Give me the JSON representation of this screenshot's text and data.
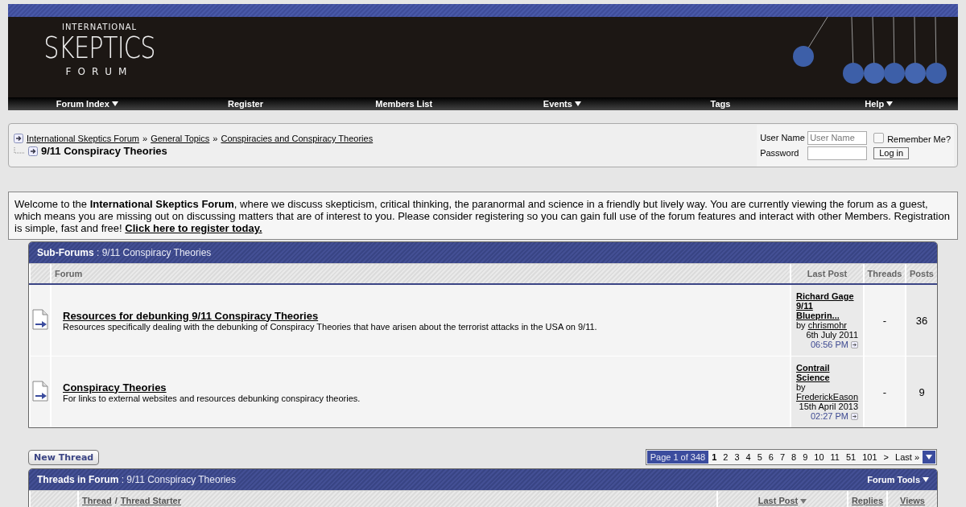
{
  "logo": {
    "line_1": "INTERNATIONAL",
    "line_2": "SKEPTICS",
    "line_3": "FORUM"
  },
  "nav": [
    {
      "label": "Forum Index",
      "dropdown": true
    },
    {
      "label": "Register",
      "dropdown": false
    },
    {
      "label": "Members List",
      "dropdown": false
    },
    {
      "label": "Events",
      "dropdown": true
    },
    {
      "label": "Tags",
      "dropdown": false
    },
    {
      "label": "Help",
      "dropdown": true
    }
  ],
  "breadcrumb": {
    "links": [
      "International Skeptics Forum",
      "General Topics",
      "Conspiracies and Conspiracy Theories"
    ],
    "separator": "»",
    "current": "9/11 Conspiracy Theories"
  },
  "login": {
    "username_label": "User Name",
    "username_placeholder": "User Name",
    "password_label": "Password",
    "remember_label": "Remember Me?",
    "remember_checked": false,
    "button": "Log in"
  },
  "welcome": {
    "text": "Welcome to the **International Skeptics Forum**, where we discuss skepticism, critical thinking, the paranormal and science in a friendly but lively way. You are currently viewing the forum as a guest, which means you are missing out on discussing matters that are of interest to you. Please consider registering so you can gain full use of the forum features and interact with other Members. Registration is simple, fast and free!",
    "link": "Click here to register today."
  },
  "subforums": {
    "title": "Sub-Forums",
    "subtitle": ": 9/11 Conspiracy Theories",
    "columns": [
      "Forum",
      "Last Post",
      "Threads",
      "Posts"
    ],
    "rows": [
      {
        "title": "Resources for debunking 9/11 Conspiracy Theories",
        "description": "Resources specifically dealing with the debunking of Conspiracy Theories that have arisen about the terrorist attacks in the USA on 9/11.",
        "last_title": "Richard Gage 9/11 Blueprin...",
        "last_by": "by",
        "last_user": "chrismohr",
        "last_date": "6th July 2011",
        "last_time": "06:56 PM",
        "threads": "-",
        "posts": "36"
      },
      {
        "title": "Conspiracy Theories",
        "description": "For links to external websites and resources debunking conspiracy theories.",
        "last_title": "Contrail Science",
        "last_by": "by",
        "last_user": "FrederickEason",
        "last_date": "15th April 2013",
        "last_time": "02:27 PM",
        "threads": "-",
        "posts": "9"
      }
    ]
  },
  "new_thread_button": "New Thread",
  "pagination": {
    "label": "Page 1 of 348",
    "pages": [
      {
        "label": "1",
        "selected": true
      },
      {
        "label": "2",
        "selected": false
      },
      {
        "label": "3",
        "selected": false
      },
      {
        "label": "4",
        "selected": false
      },
      {
        "label": "5",
        "selected": false
      },
      {
        "label": "6",
        "selected": false
      },
      {
        "label": "7",
        "selected": false
      },
      {
        "label": "8",
        "selected": false
      },
      {
        "label": "9",
        "selected": false
      },
      {
        "label": "10",
        "selected": false
      },
      {
        "label": "11",
        "selected": false
      },
      {
        "label": "51",
        "selected": false
      },
      {
        "label": "101",
        "selected": false
      },
      {
        "label": ">",
        "selected": false
      },
      {
        "label": "Last »",
        "selected": false
      }
    ]
  },
  "threads": {
    "title": "Threads in Forum",
    "subtitle": ": 9/11 Conspiracy Theories",
    "tools": "Forum Tools",
    "columns": [
      {
        "label": "Thread",
        "link": true
      },
      {
        "label": "/",
        "link": false
      },
      {
        "label": "Thread Starter",
        "link": true
      }
    ],
    "last_post": "Last Post",
    "replies": "Replies",
    "views": "Views"
  }
}
